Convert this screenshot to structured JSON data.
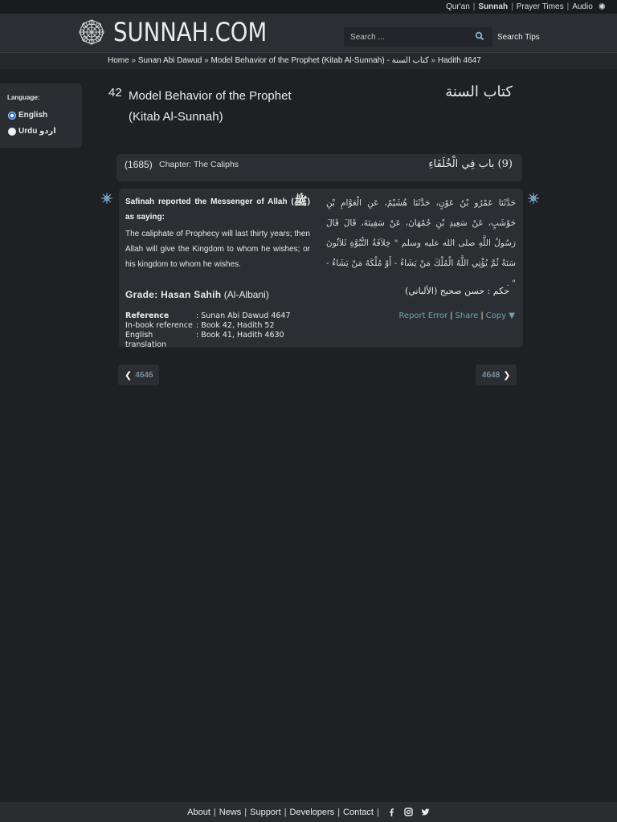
{
  "topbar": {
    "quran": "Qur'an",
    "sunnah": "Sunnah",
    "prayer_times": "Prayer Times",
    "audio": "Audio",
    "sep": "|"
  },
  "header": {
    "logo_text": "SUNNAH.COM",
    "search_placeholder": "Search ...",
    "search_tips": "Search Tips"
  },
  "breadcrumb": {
    "items": [
      "Home",
      "Sunan Abi Dawud",
      "Model Behavior of the Prophet (Kitab Al-Sunnah) - كتاب السنة",
      "Hadith 4647"
    ],
    "sep": " » "
  },
  "language": {
    "title": "Language:",
    "english": "English",
    "urdu": "Urdu  اردو",
    "selected": "English"
  },
  "book": {
    "number": "42",
    "title": "Model Behavior of the Prophet (Kitab Al-Sunnah)",
    "arabic": "كتاب السنة"
  },
  "chapter": {
    "number": "(1685)",
    "title": "Chapter: The Caliphs",
    "arabic": "(9) باب فِي الْخُلَفَاءِ"
  },
  "hadith": {
    "narrator": "Safinah reported the Messenger of Allah (",
    "pbuh": "ﷺ",
    "narrator_end": ") as saying:",
    "text": "The caliphate of Prophecy will last thirty years; then Allah will give the Kingdom to whom he wishes; or his kingdom to whom he wishes.",
    "arabic": "حَدَّثَنَا عَمْرُو بْنُ عَوْنٍ، حَدَّثَنَا هُشَيْمٌ، عَنِ الْعَوَّامِ بْنِ حَوْشَبٍ، عَنْ سَعِيدِ بْنِ جُمْهَانَ، عَنْ سَفِينَةَ، قَالَ قَالَ رَسُولُ اللَّهِ صلى الله عليه وسلم ‏\"‏ خِلاَفَةُ النُّبُوَّةِ ثَلاَثُونَ سَنَةً ثُمَّ يُؤْتِي اللَّهُ الْمُلْكَ مَنْ يَشَاءُ - أَوْ مُلْكَهُ مَنْ يَشَاءُ - ‏\"‏ ‏.‏",
    "grade_label": "Grade",
    "grade_value": ": Hasan Sahih",
    "grade_source": "(Al-Albani)",
    "grade_arabic": "حكم   :   حسن صحيح   (الألباني)"
  },
  "references": [
    {
      "key": "Reference",
      "value": ": Sunan Abi Dawud 4647"
    },
    {
      "key": "In-book reference",
      "value": ": Book 42, Hadith 52"
    },
    {
      "key": "English translation",
      "value": ": Book 41, Hadith 4630"
    }
  ],
  "actions": {
    "report": "Report Error",
    "share": "Share",
    "copy": "Copy ▼",
    "sep": "|"
  },
  "nav": {
    "prev": "4646",
    "next": "4648"
  },
  "footer": {
    "about": "About",
    "news": "News",
    "support": "Support",
    "developers": "Developers",
    "contact": "Contact",
    "sep": "|"
  },
  "colors": {
    "background": "#1f2024",
    "panel": "#2b2e32",
    "link": "#6fa2b5",
    "radio_selected": "#1e6fd9"
  },
  "icons": [
    "settings-icon",
    "logo-icon",
    "search-icon",
    "hadith-star-icon",
    "chevron-left-icon",
    "chevron-right-icon",
    "facebook-icon",
    "instagram-icon",
    "twitter-icon"
  ]
}
